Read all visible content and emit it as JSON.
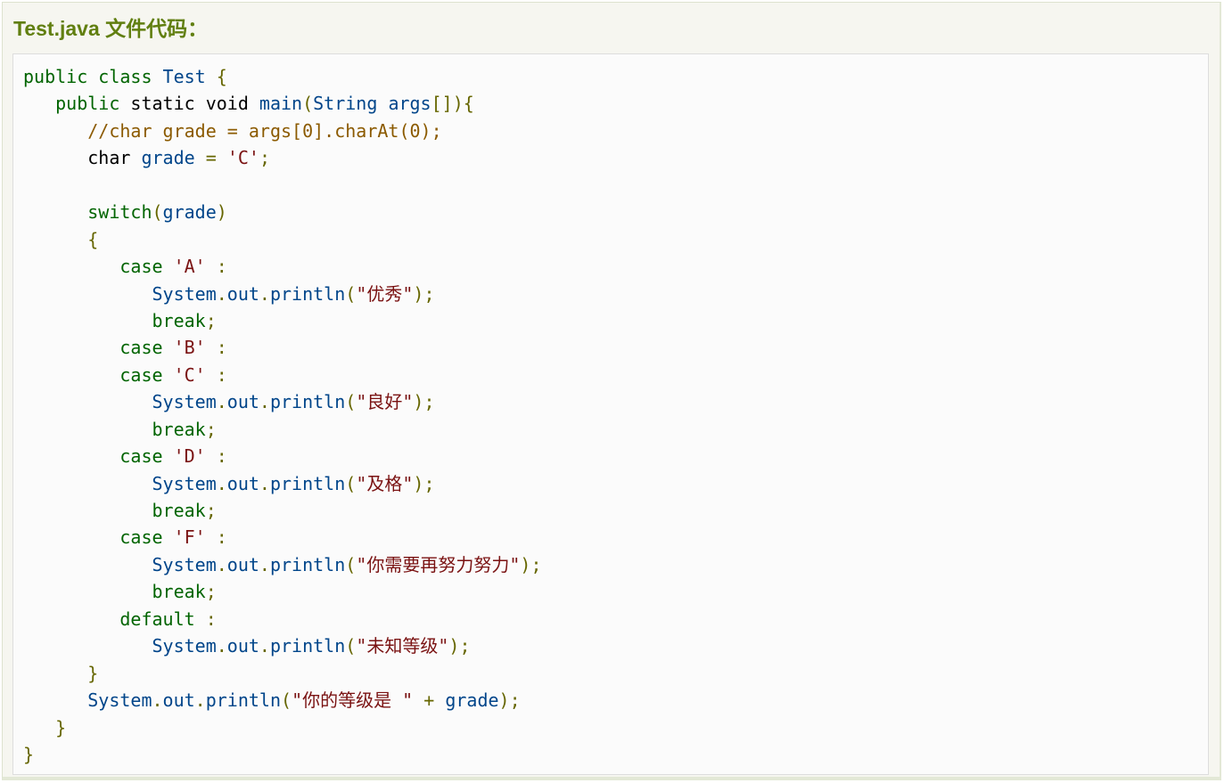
{
  "title": "Test.java 文件代码：",
  "code": {
    "language": "java",
    "lines": [
      [
        [
          "kw",
          "public"
        ],
        [
          "kw",
          " class "
        ],
        [
          "id",
          "Test"
        ],
        [
          "pn",
          " {"
        ]
      ],
      [
        [
          "ty",
          "   "
        ],
        [
          "kw",
          "public"
        ],
        [
          "ty",
          " static void "
        ],
        [
          "id",
          "main"
        ],
        [
          "pn",
          "("
        ],
        [
          "id",
          "String"
        ],
        [
          "ty",
          " "
        ],
        [
          "id",
          "args"
        ],
        [
          "pn",
          "[]){"
        ]
      ],
      [
        [
          "ty",
          "      "
        ],
        [
          "cm",
          "//char grade = args[0].charAt(0);"
        ]
      ],
      [
        [
          "ty",
          "      char "
        ],
        [
          "id",
          "grade"
        ],
        [
          "ty",
          " "
        ],
        [
          "pn",
          "="
        ],
        [
          "ty",
          " "
        ],
        [
          "st",
          "'C'"
        ],
        [
          "pn",
          ";"
        ]
      ],
      [],
      [
        [
          "ty",
          "      "
        ],
        [
          "kw",
          "switch"
        ],
        [
          "pn",
          "("
        ],
        [
          "id",
          "grade"
        ],
        [
          "pn",
          ")"
        ]
      ],
      [
        [
          "ty",
          "      "
        ],
        [
          "pn",
          "{"
        ]
      ],
      [
        [
          "ty",
          "         "
        ],
        [
          "kw",
          "case"
        ],
        [
          "ty",
          " "
        ],
        [
          "st",
          "'A'"
        ],
        [
          "ty",
          " "
        ],
        [
          "pn",
          ":"
        ]
      ],
      [
        [
          "ty",
          "            "
        ],
        [
          "id",
          "System"
        ],
        [
          "pn",
          "."
        ],
        [
          "id",
          "out"
        ],
        [
          "pn",
          "."
        ],
        [
          "id",
          "println"
        ],
        [
          "pn",
          "("
        ],
        [
          "st",
          "\"优秀\""
        ],
        [
          "pn",
          ");"
        ]
      ],
      [
        [
          "ty",
          "            "
        ],
        [
          "kw",
          "break"
        ],
        [
          "pn",
          ";"
        ]
      ],
      [
        [
          "ty",
          "         "
        ],
        [
          "kw",
          "case"
        ],
        [
          "ty",
          " "
        ],
        [
          "st",
          "'B'"
        ],
        [
          "ty",
          " "
        ],
        [
          "pn",
          ":"
        ]
      ],
      [
        [
          "ty",
          "         "
        ],
        [
          "kw",
          "case"
        ],
        [
          "ty",
          " "
        ],
        [
          "st",
          "'C'"
        ],
        [
          "ty",
          " "
        ],
        [
          "pn",
          ":"
        ]
      ],
      [
        [
          "ty",
          "            "
        ],
        [
          "id",
          "System"
        ],
        [
          "pn",
          "."
        ],
        [
          "id",
          "out"
        ],
        [
          "pn",
          "."
        ],
        [
          "id",
          "println"
        ],
        [
          "pn",
          "("
        ],
        [
          "st",
          "\"良好\""
        ],
        [
          "pn",
          ");"
        ]
      ],
      [
        [
          "ty",
          "            "
        ],
        [
          "kw",
          "break"
        ],
        [
          "pn",
          ";"
        ]
      ],
      [
        [
          "ty",
          "         "
        ],
        [
          "kw",
          "case"
        ],
        [
          "ty",
          " "
        ],
        [
          "st",
          "'D'"
        ],
        [
          "ty",
          " "
        ],
        [
          "pn",
          ":"
        ]
      ],
      [
        [
          "ty",
          "            "
        ],
        [
          "id",
          "System"
        ],
        [
          "pn",
          "."
        ],
        [
          "id",
          "out"
        ],
        [
          "pn",
          "."
        ],
        [
          "id",
          "println"
        ],
        [
          "pn",
          "("
        ],
        [
          "st",
          "\"及格\""
        ],
        [
          "pn",
          ");"
        ]
      ],
      [
        [
          "ty",
          "            "
        ],
        [
          "kw",
          "break"
        ],
        [
          "pn",
          ";"
        ]
      ],
      [
        [
          "ty",
          "         "
        ],
        [
          "kw",
          "case"
        ],
        [
          "ty",
          " "
        ],
        [
          "st",
          "'F'"
        ],
        [
          "ty",
          " "
        ],
        [
          "pn",
          ":"
        ]
      ],
      [
        [
          "ty",
          "            "
        ],
        [
          "id",
          "System"
        ],
        [
          "pn",
          "."
        ],
        [
          "id",
          "out"
        ],
        [
          "pn",
          "."
        ],
        [
          "id",
          "println"
        ],
        [
          "pn",
          "("
        ],
        [
          "st",
          "\"你需要再努力努力\""
        ],
        [
          "pn",
          ");"
        ]
      ],
      [
        [
          "ty",
          "            "
        ],
        [
          "kw",
          "break"
        ],
        [
          "pn",
          ";"
        ]
      ],
      [
        [
          "ty",
          "         "
        ],
        [
          "kw",
          "default"
        ],
        [
          "ty",
          " "
        ],
        [
          "pn",
          ":"
        ]
      ],
      [
        [
          "ty",
          "            "
        ],
        [
          "id",
          "System"
        ],
        [
          "pn",
          "."
        ],
        [
          "id",
          "out"
        ],
        [
          "pn",
          "."
        ],
        [
          "id",
          "println"
        ],
        [
          "pn",
          "("
        ],
        [
          "st",
          "\"未知等级\""
        ],
        [
          "pn",
          ");"
        ]
      ],
      [
        [
          "ty",
          "      "
        ],
        [
          "pn",
          "}"
        ]
      ],
      [
        [
          "ty",
          "      "
        ],
        [
          "id",
          "System"
        ],
        [
          "pn",
          "."
        ],
        [
          "id",
          "out"
        ],
        [
          "pn",
          "."
        ],
        [
          "id",
          "println"
        ],
        [
          "pn",
          "("
        ],
        [
          "st",
          "\"你的等级是 \""
        ],
        [
          "ty",
          " "
        ],
        [
          "pn",
          "+"
        ],
        [
          "ty",
          " "
        ],
        [
          "id",
          "grade"
        ],
        [
          "pn",
          ");"
        ]
      ],
      [
        [
          "ty",
          "   "
        ],
        [
          "pn",
          "}"
        ]
      ],
      [
        [
          "pn",
          "}"
        ]
      ]
    ]
  }
}
